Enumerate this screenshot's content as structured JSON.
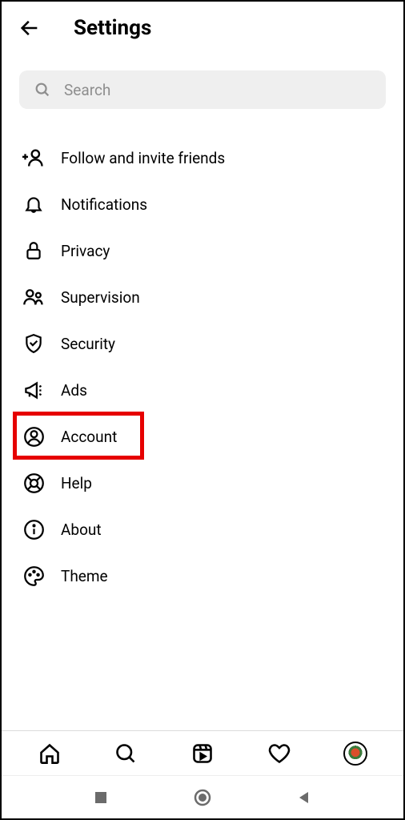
{
  "header": {
    "title": "Settings"
  },
  "search": {
    "placeholder": "Search"
  },
  "menu": {
    "items": [
      {
        "label": "Follow and invite friends"
      },
      {
        "label": "Notifications"
      },
      {
        "label": "Privacy"
      },
      {
        "label": "Supervision"
      },
      {
        "label": "Security"
      },
      {
        "label": "Ads"
      },
      {
        "label": "Account"
      },
      {
        "label": "Help"
      },
      {
        "label": "About"
      },
      {
        "label": "Theme"
      }
    ]
  },
  "highlighted_item_index": 6
}
